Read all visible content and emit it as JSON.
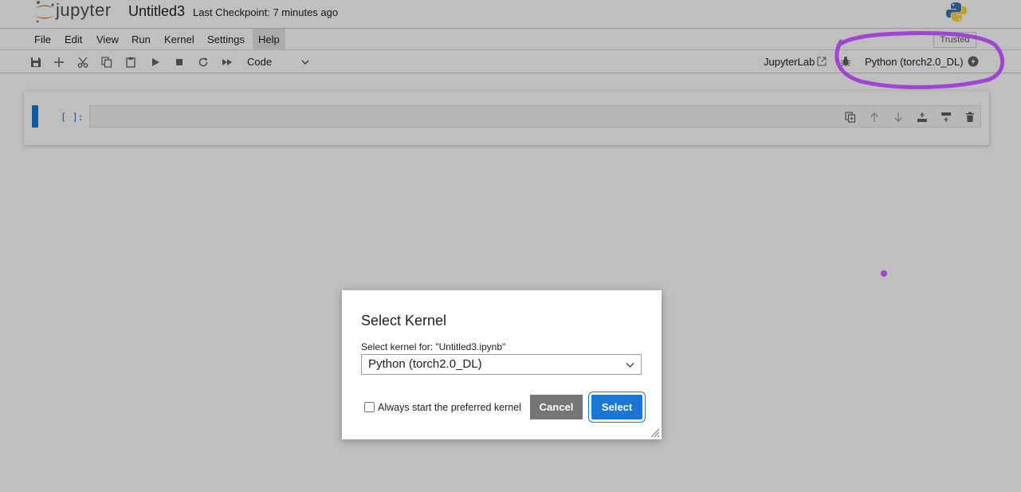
{
  "header": {
    "logo_text": "jupyter",
    "notebook_title": "Untitled3",
    "checkpoint": "Last Checkpoint: 7 minutes ago"
  },
  "menu": {
    "items": [
      "File",
      "Edit",
      "View",
      "Run",
      "Kernel",
      "Settings",
      "Help"
    ],
    "active": "Help",
    "trusted_label": "Trusted"
  },
  "toolbar": {
    "cell_type": "Code",
    "jupyterlab_link": "JupyterLab",
    "kernel_name": "Python (torch2.0_DL)",
    "icons": [
      "save-icon",
      "add-icon",
      "cut-icon",
      "copy-icon",
      "paste-icon",
      "run-icon",
      "stop-icon",
      "restart-icon",
      "fast-forward-icon"
    ]
  },
  "cell": {
    "prompt": "[ ]:",
    "tools": [
      "duplicate-icon",
      "move-up-icon",
      "move-down-icon",
      "insert-above-icon",
      "insert-below-icon",
      "delete-icon"
    ]
  },
  "dialog": {
    "title": "Select Kernel",
    "label": "Select kernel for: \"Untitled3.ipynb\"",
    "selected_kernel": "Python (torch2.0_DL)",
    "checkbox_label": "Always start the preferred kernel",
    "checkbox_checked": false,
    "cancel_label": "Cancel",
    "select_label": "Select"
  },
  "colors": {
    "accent": "#1976d2",
    "annotation": "#a044d4",
    "cancel": "#757575"
  }
}
